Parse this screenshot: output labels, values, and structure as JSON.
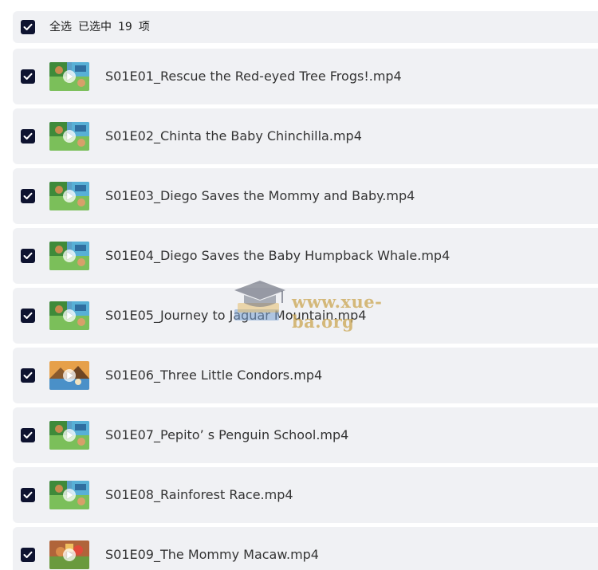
{
  "header": {
    "select_all_label": "全选",
    "selected_prefix": "已选中",
    "selected_count": "19",
    "selected_suffix": "项",
    "checked": true
  },
  "files": [
    {
      "name": "S01E01_Rescue the Red-eyed Tree Frogs!.mp4",
      "checked": true,
      "thumb_icon": "jungle-thumbnail-icon"
    },
    {
      "name": "S01E02_Chinta the Baby Chinchilla.mp4",
      "checked": true,
      "thumb_icon": "jungle-thumbnail-icon"
    },
    {
      "name": "S01E03_Diego Saves the Mommy and Baby.mp4",
      "checked": true,
      "thumb_icon": "jungle-thumbnail-icon"
    },
    {
      "name": "S01E04_Diego Saves the Baby Humpback Whale.mp4",
      "checked": true,
      "thumb_icon": "jungle-thumbnail-icon"
    },
    {
      "name": "S01E05_Journey to Jaguar Mountain.mp4",
      "checked": true,
      "thumb_icon": "jungle-thumbnail-icon"
    },
    {
      "name": "S01E06_Three Little Condors.mp4",
      "checked": true,
      "thumb_icon": "mountain-thumbnail-icon"
    },
    {
      "name": "S01E07_Pepito’ s Penguin School.mp4",
      "checked": true,
      "thumb_icon": "jungle-thumbnail-icon"
    },
    {
      "name": "S01E08_Rainforest Race.mp4",
      "checked": true,
      "thumb_icon": "jungle-thumbnail-icon"
    },
    {
      "name": "S01E09_The Mommy Macaw.mp4",
      "checked": true,
      "thumb_icon": "forest-thumbnail-icon"
    }
  ],
  "watermark": {
    "text": "www.xue-ba.org",
    "icon": "graduation-cap-icon"
  },
  "colors": {
    "row_background": "#f0f1f4",
    "checkbox_fill": "#0e1330",
    "text": "#333333",
    "watermark": "#cdaa5a"
  }
}
